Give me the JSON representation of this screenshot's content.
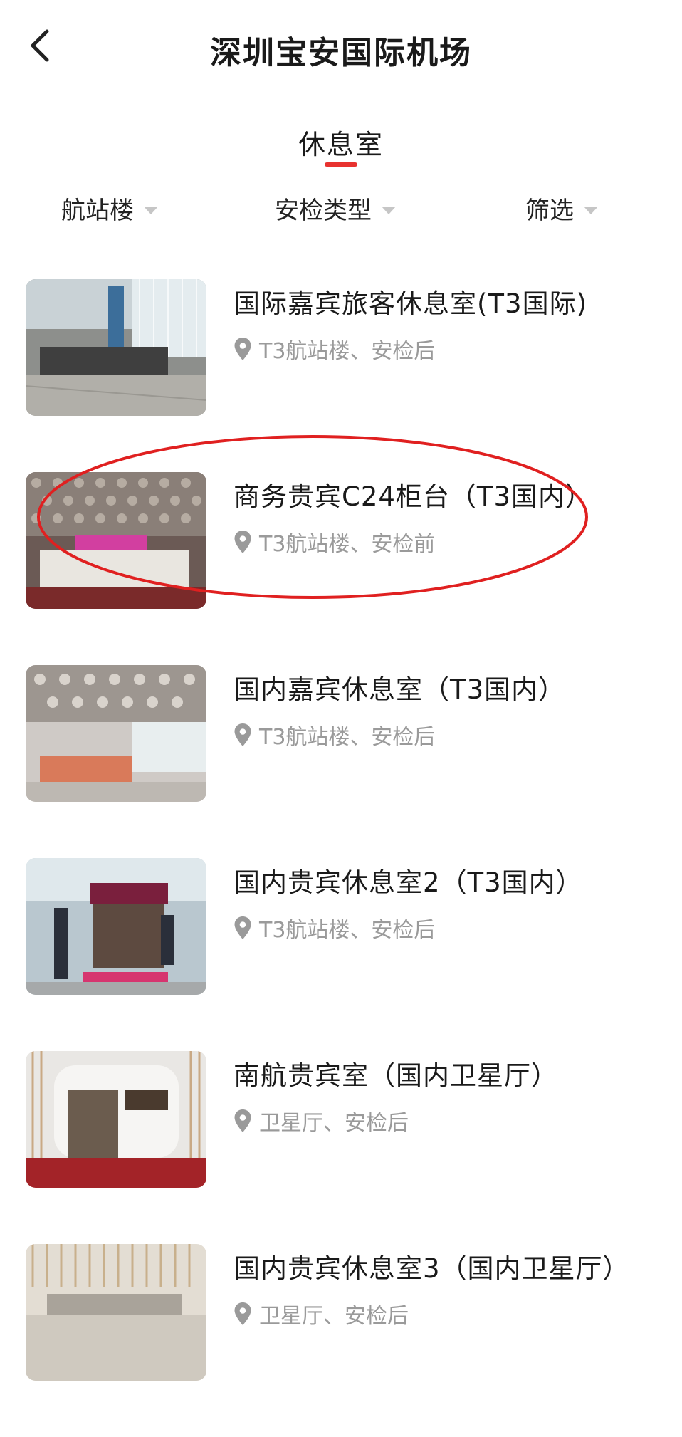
{
  "header": {
    "title": "深圳宝安国际机场",
    "back_icon": "chevron-left-icon"
  },
  "tabs": [
    {
      "label": "休息室",
      "active": true
    }
  ],
  "filters": [
    {
      "label": "航站楼"
    },
    {
      "label": "安检类型"
    },
    {
      "label": "筛选"
    }
  ],
  "lounges": [
    {
      "title": "国际嘉宾旅客休息室(T3国际)",
      "location": "T3航站楼、安检后"
    },
    {
      "title": "商务贵宾C24柜台（T3国内）",
      "location": "T3航站楼、安检前"
    },
    {
      "title": "国内嘉宾休息室（T3国内）",
      "location": "T3航站楼、安检后"
    },
    {
      "title": "国内贵宾休息室2（T3国内）",
      "location": "T3航站楼、安检后"
    },
    {
      "title": "南航贵宾室（国内卫星厅）",
      "location": "卫星厅、安检后"
    },
    {
      "title": "国内贵宾休息室3（国内卫星厅）",
      "location": "卫星厅、安检后"
    }
  ],
  "colors": {
    "accent": "#e8322f",
    "annotation": "#e02020",
    "secondary_text": "#9a9a9a"
  }
}
